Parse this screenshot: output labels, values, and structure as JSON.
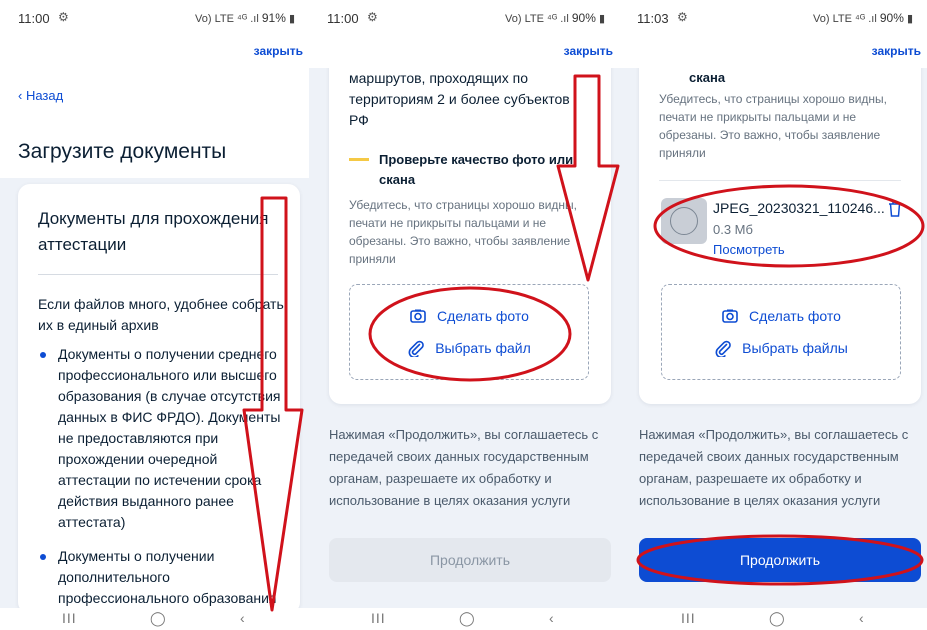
{
  "status_bar": [
    {
      "time": "11:00",
      "battery": "91%",
      "network": "Vo) LTE ⁴ᴳ"
    },
    {
      "time": "11:00",
      "battery": "90%",
      "network": "Vo) LTE ⁴ᴳ"
    },
    {
      "time": "11:03",
      "battery": "90%",
      "network": "Vo) LTE ⁴ᴳ"
    }
  ],
  "close_label": "закрыть",
  "screen1": {
    "back_label": "‹ Назад",
    "page_title": "Загрузите документы",
    "card_title": "Документы для прохождения аттестации",
    "intro": "Если файлов много, удобнее собрать их в единый архив",
    "bullets": [
      "Документы о получении среднего профессионального или высшего образования (в случае отсутствия данных в ФИС ФРДО). Документы не предоставляются при прохождении очередной аттестации по истечении срока действия выданного ранее аттестата)",
      "Документы о получении дополнительного профессионального образования"
    ]
  },
  "screen2": {
    "route_text": "маршрутов, проходящих по территориям 2 и более субъектов РФ",
    "warn_title": "Проверьте качество фото или скана",
    "warn_text": "Убедитесь, что страницы хорошо видны, печати не прикрыты пальцами и не обрезаны. Это важно, чтобы заявление приняли",
    "take_photo": "Сделать фото",
    "choose_file": "Выбрать файл",
    "consent": "Нажимая «Продолжить», вы соглашаетесь с передачей своих данных государственным органам, разрешаете их обработку и использование в целях оказания услуги",
    "continue": "Продолжить"
  },
  "screen3": {
    "warn_title": "скана",
    "warn_text": "Убедитесь, что страницы хорошо видны, печати не прикрыты пальцами и не обрезаны. Это важно, чтобы заявление приняли",
    "file_name": "JPEG_20230321_110246...",
    "file_size": "0.3 Мб",
    "view_label": "Посмотреть",
    "take_photo": "Сделать фото",
    "choose_files": "Выбрать файлы",
    "consent": "Нажимая «Продолжить», вы соглашаетесь с передачей своих данных государственным органам, разрешаете их обработку и использование в целях оказания услуги",
    "continue": "Продолжить"
  },
  "nav_bar": {
    "recents": "III",
    "home": "◯",
    "back": "‹"
  },
  "colors": {
    "accent": "#0d4cd3",
    "annotation": "#d0121b",
    "warning": "#f5c945",
    "background": "#eef2f8"
  }
}
